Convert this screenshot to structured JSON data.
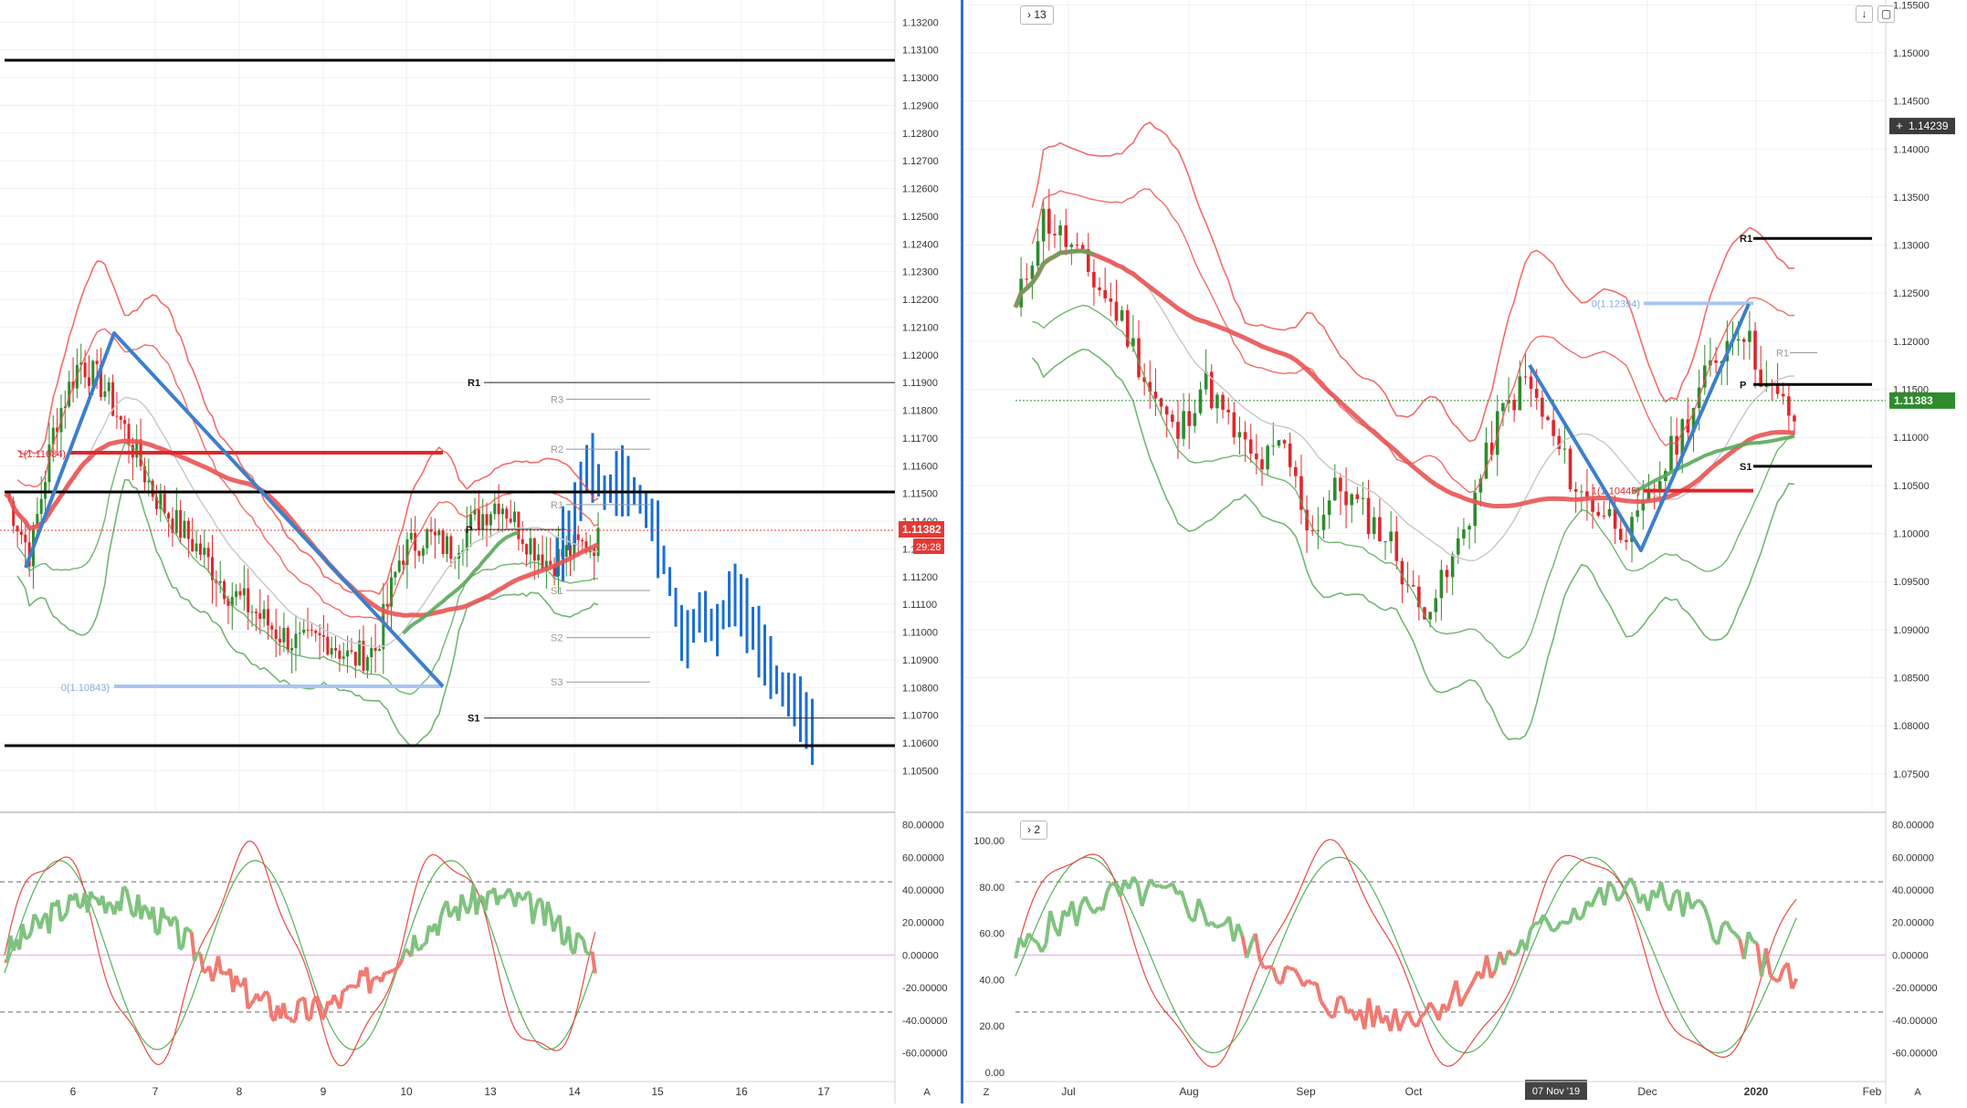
{
  "left_panel": {
    "price_ticks": [
      "1.13200",
      "1.13100",
      "1.13000",
      "1.12900",
      "1.12800",
      "1.12700",
      "1.12600",
      "1.12500",
      "1.12400",
      "1.12300",
      "1.12200",
      "1.12100",
      "1.12000",
      "1.11900",
      "1.11800",
      "1.11700",
      "1.11600",
      "1.11500",
      "1.11400",
      "1.11300",
      "1.11200",
      "1.11100",
      "1.11000",
      "1.10900",
      "1.10800",
      "1.10700",
      "1.10600",
      "1.10500"
    ],
    "price_range": [
      1.1035,
      1.1328
    ],
    "current_price": "1.11382",
    "countdown": "29:28",
    "x_labels": [
      "6",
      "7",
      "8",
      "9",
      "10",
      "13",
      "14",
      "15",
      "16",
      "17"
    ],
    "osc_ticks": [
      "80.00000",
      "60.00000",
      "40.00000",
      "20.00000",
      "0.00000",
      "-20.00000",
      "-40.00000",
      "-60.00000"
    ],
    "osc_range": [
      -72,
      82
    ],
    "pivots": [
      {
        "label": "R1",
        "value": 1.119
      },
      {
        "label": "R3",
        "value": 1.1184
      },
      {
        "label": "R2",
        "value": 1.1166
      },
      {
        "label": "R1",
        "value": 1.1146
      },
      {
        "label": "P",
        "value": 1.1137
      },
      {
        "label": "S1",
        "value": 1.1115
      },
      {
        "label": "S2",
        "value": 1.1098
      },
      {
        "label": "S3",
        "value": 1.1082
      },
      {
        "label": "S1",
        "value": 1.1069
      }
    ],
    "fib_labels": [
      "0(1.10843)",
      "1(1.11684)"
    ],
    "axis_letter": "A"
  },
  "right_panel": {
    "collapse_label": "13",
    "osc_collapse_label": "2",
    "price_ticks": [
      "1.15500",
      "1.15000",
      "1.14500",
      "1.14000",
      "1.13500",
      "1.13000",
      "1.12500",
      "1.12000",
      "1.11500",
      "1.11000",
      "1.10500",
      "1.10000",
      "1.09500",
      "1.09000",
      "1.08500",
      "1.08000",
      "1.07500"
    ],
    "price_range": [
      1.071,
      1.1555
    ],
    "current_price": "1.11383",
    "crosshair_price": "1.14239",
    "x_labels": [
      "Jul",
      "Aug",
      "Sep",
      "Oct",
      "Dec",
      "2020",
      "Feb"
    ],
    "x_date_label": "07 Nov '19",
    "osc_left_ticks": [
      "100.00",
      "80.00",
      "60.00",
      "40.00",
      "20.00",
      "0.00"
    ],
    "osc_right_ticks": [
      "80.00000",
      "60.00000",
      "40.00000",
      "20.00000",
      "0.00000",
      "-20.00000",
      "-40.00000",
      "-60.00000"
    ],
    "osc_range": [
      -72,
      82
    ],
    "pivots": [
      {
        "label": "R1",
        "value": 1.1307
      },
      {
        "label": "R1",
        "value": 1.1188
      },
      {
        "label": "P",
        "value": 1.1155
      },
      {
        "label": "S1",
        "value": 1.107
      }
    ],
    "fib_labels": [
      "0(1.12394)",
      "1(1.10445)"
    ],
    "axis_letters": [
      "Z",
      "A"
    ]
  },
  "colors": {
    "bull": "#2e8b2e",
    "bear": "#e0262b",
    "blue_candle": "#1b6fd6",
    "red_line": "#ef5350",
    "green_line": "#5aa85a",
    "trend": "#3d7fc9",
    "fib": "#a9c6f0",
    "price_tag": "#e53935",
    "price_tag_green": "#2e8b2e"
  }
}
